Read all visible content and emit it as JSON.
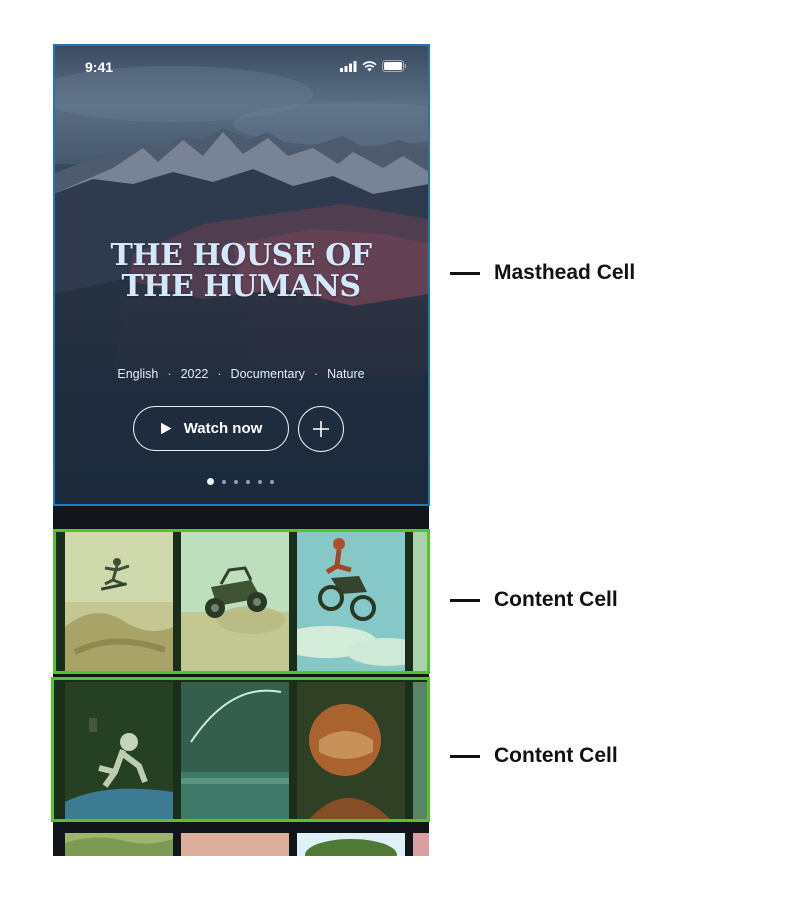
{
  "status_bar": {
    "time": "9:41"
  },
  "masthead": {
    "title": "THE HOUSE OF\nTHE HUMANS",
    "meta": [
      "English",
      "2022",
      "Documentary",
      "Nature"
    ],
    "meta_separator": "·",
    "watch_label": "Watch now",
    "pager": {
      "count": 6,
      "active_index": 0
    }
  },
  "content_rows": [
    {
      "tiles": [
        "skateboarder-jump",
        "dune-buggy-jump",
        "motocross-jump",
        "partial-tile"
      ]
    },
    {
      "tiles": [
        "astronaut-spacewalk",
        "rocket-launch",
        "astronaut-helmet",
        "partial-tile"
      ]
    },
    {
      "tiles": [
        "green-hills",
        "pink-sky",
        "tree-canopy",
        "partial-tile"
      ]
    }
  ],
  "annotations": {
    "masthead_label": "Masthead Cell",
    "content_label_1": "Content Cell",
    "content_label_2": "Content Cell"
  },
  "colors": {
    "masthead_outline": "#1c78c0",
    "content_outline": "#54c32e",
    "title_color": "#d4e8fb",
    "app_background": "#121519"
  }
}
